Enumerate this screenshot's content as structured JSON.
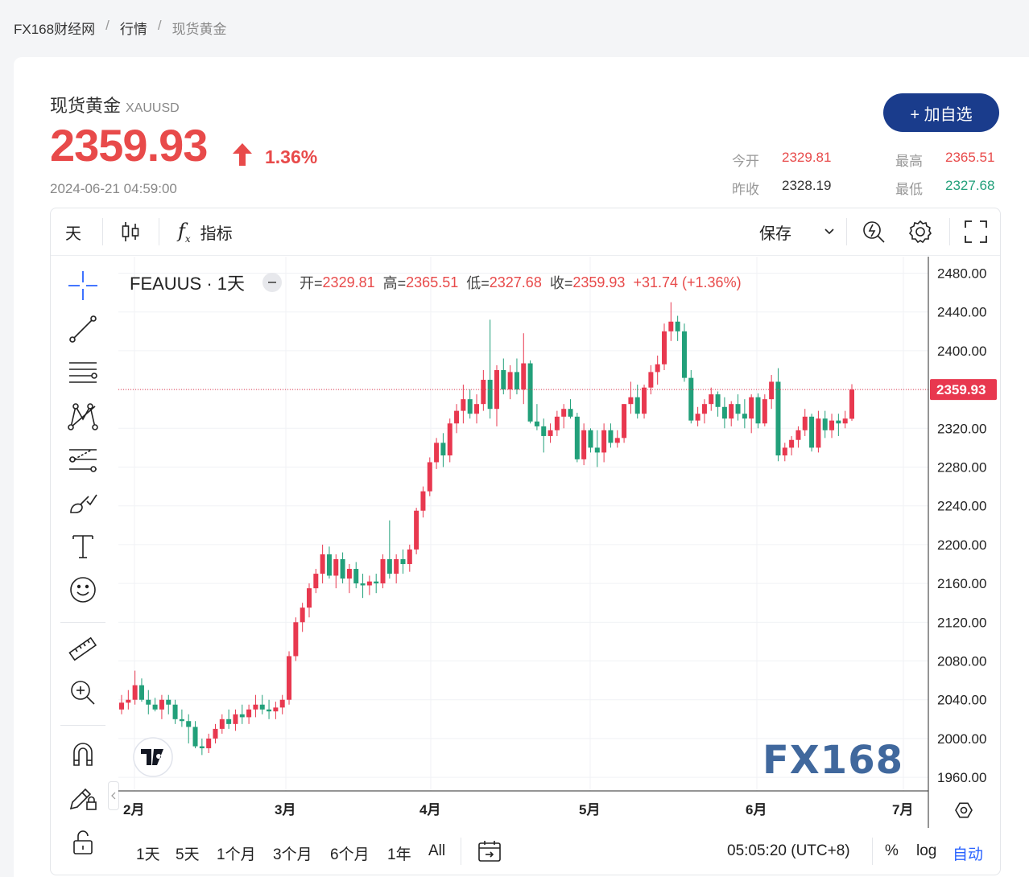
{
  "breadcrumb": [
    "FX168财经网",
    "行情",
    "现货黄金"
  ],
  "quote": {
    "name": "现货黄金",
    "code": "XAUUSD",
    "price": "2359.93",
    "change_pct": "1.36%",
    "time": "2024-06-21 04:59:00",
    "add_label": "+ 加自选",
    "open_label": "今开",
    "open": "2329.81",
    "high_label": "最高",
    "high": "2365.51",
    "prev_label": "昨收",
    "prev": "2328.19",
    "low_label": "最低",
    "low": "2327.68"
  },
  "toolbar": {
    "interval": "天",
    "indicators": "指标",
    "save": "保存"
  },
  "legend": {
    "symbol": "FEAUUS · 1天",
    "o_label": "开=",
    "o": "2329.81",
    "h_label": "高=",
    "h": "2365.51",
    "l_label": "低=",
    "l": "2327.68",
    "c_label": "收=",
    "c": "2359.93",
    "chg": "+31.74 (+1.36%)"
  },
  "bottom": {
    "ranges": [
      "1天",
      "5天",
      "1个月",
      "3个月",
      "6个月",
      "1年",
      "All"
    ],
    "clock": "05:05:20 (UTC+8)",
    "pct": "%",
    "log": "log",
    "auto": "自动"
  },
  "colors": {
    "up": "#e8384f",
    "down": "#22a07a",
    "accent": "#1a3c8c"
  },
  "chart_data": {
    "type": "candlestick",
    "y_ticks": [
      "2480.00",
      "2440.00",
      "2400.00",
      "2360.00",
      "2320.00",
      "2280.00",
      "2240.00",
      "2200.00",
      "2160.00",
      "2120.00",
      "2080.00",
      "2040.00",
      "2000.00",
      "1960.00"
    ],
    "x_ticks": [
      "2月",
      "3月",
      "4月",
      "5月",
      "6月",
      "7月"
    ],
    "ylim": [
      1946,
      2497
    ],
    "last_price": "2359.93",
    "watermark": "FX168",
    "series": [
      {
        "o": 2030,
        "h": 2045,
        "l": 2025,
        "c": 2037
      },
      {
        "o": 2037,
        "h": 2050,
        "l": 2030,
        "c": 2040
      },
      {
        "o": 2040,
        "h": 2070,
        "l": 2035,
        "c": 2055
      },
      {
        "o": 2055,
        "h": 2062,
        "l": 2038,
        "c": 2040
      },
      {
        "o": 2040,
        "h": 2050,
        "l": 2025,
        "c": 2035
      },
      {
        "o": 2035,
        "h": 2042,
        "l": 2028,
        "c": 2030
      },
      {
        "o": 2030,
        "h": 2045,
        "l": 2020,
        "c": 2040
      },
      {
        "o": 2040,
        "h": 2045,
        "l": 2025,
        "c": 2035
      },
      {
        "o": 2035,
        "h": 2040,
        "l": 2015,
        "c": 2020
      },
      {
        "o": 2020,
        "h": 2030,
        "l": 2012,
        "c": 2018
      },
      {
        "o": 2018,
        "h": 2025,
        "l": 1995,
        "c": 2012
      },
      {
        "o": 2012,
        "h": 2018,
        "l": 1990,
        "c": 1992
      },
      {
        "o": 1992,
        "h": 2000,
        "l": 1983,
        "c": 1990
      },
      {
        "o": 1990,
        "h": 2005,
        "l": 1985,
        "c": 2000
      },
      {
        "o": 2000,
        "h": 2015,
        "l": 1995,
        "c": 2010
      },
      {
        "o": 2010,
        "h": 2025,
        "l": 2005,
        "c": 2020
      },
      {
        "o": 2020,
        "h": 2030,
        "l": 2010,
        "c": 2015
      },
      {
        "o": 2015,
        "h": 2030,
        "l": 2008,
        "c": 2025
      },
      {
        "o": 2025,
        "h": 2035,
        "l": 2015,
        "c": 2022
      },
      {
        "o": 2022,
        "h": 2035,
        "l": 2015,
        "c": 2030
      },
      {
        "o": 2030,
        "h": 2045,
        "l": 2022,
        "c": 2035
      },
      {
        "o": 2035,
        "h": 2045,
        "l": 2025,
        "c": 2030
      },
      {
        "o": 2030,
        "h": 2040,
        "l": 2020,
        "c": 2028
      },
      {
        "o": 2028,
        "h": 2038,
        "l": 2020,
        "c": 2032
      },
      {
        "o": 2032,
        "h": 2045,
        "l": 2025,
        "c": 2040
      },
      {
        "o": 2040,
        "h": 2090,
        "l": 2035,
        "c": 2085
      },
      {
        "o": 2085,
        "h": 2125,
        "l": 2080,
        "c": 2120
      },
      {
        "o": 2120,
        "h": 2140,
        "l": 2110,
        "c": 2135
      },
      {
        "o": 2135,
        "h": 2160,
        "l": 2125,
        "c": 2155
      },
      {
        "o": 2155,
        "h": 2175,
        "l": 2150,
        "c": 2170
      },
      {
        "o": 2170,
        "h": 2200,
        "l": 2160,
        "c": 2190
      },
      {
        "o": 2190,
        "h": 2198,
        "l": 2165,
        "c": 2168
      },
      {
        "o": 2168,
        "h": 2190,
        "l": 2155,
        "c": 2185
      },
      {
        "o": 2185,
        "h": 2192,
        "l": 2160,
        "c": 2165
      },
      {
        "o": 2165,
        "h": 2180,
        "l": 2150,
        "c": 2175
      },
      {
        "o": 2175,
        "h": 2182,
        "l": 2155,
        "c": 2160
      },
      {
        "o": 2160,
        "h": 2170,
        "l": 2145,
        "c": 2158
      },
      {
        "o": 2158,
        "h": 2168,
        "l": 2148,
        "c": 2162
      },
      {
        "o": 2162,
        "h": 2170,
        "l": 2150,
        "c": 2160
      },
      {
        "o": 2160,
        "h": 2190,
        "l": 2155,
        "c": 2185
      },
      {
        "o": 2185,
        "h": 2225,
        "l": 2165,
        "c": 2170
      },
      {
        "o": 2170,
        "h": 2190,
        "l": 2160,
        "c": 2185
      },
      {
        "o": 2185,
        "h": 2195,
        "l": 2170,
        "c": 2180
      },
      {
        "o": 2180,
        "h": 2200,
        "l": 2172,
        "c": 2195
      },
      {
        "o": 2195,
        "h": 2238,
        "l": 2190,
        "c": 2235
      },
      {
        "o": 2235,
        "h": 2260,
        "l": 2228,
        "c": 2255
      },
      {
        "o": 2255,
        "h": 2290,
        "l": 2250,
        "c": 2285
      },
      {
        "o": 2285,
        "h": 2310,
        "l": 2278,
        "c": 2305
      },
      {
        "o": 2305,
        "h": 2315,
        "l": 2280,
        "c": 2292
      },
      {
        "o": 2292,
        "h": 2330,
        "l": 2285,
        "c": 2325
      },
      {
        "o": 2325,
        "h": 2345,
        "l": 2315,
        "c": 2338
      },
      {
        "o": 2338,
        "h": 2365,
        "l": 2325,
        "c": 2350
      },
      {
        "o": 2350,
        "h": 2360,
        "l": 2330,
        "c": 2335
      },
      {
        "o": 2335,
        "h": 2355,
        "l": 2325,
        "c": 2345
      },
      {
        "o": 2345,
        "h": 2380,
        "l": 2338,
        "c": 2370
      },
      {
        "o": 2370,
        "h": 2432,
        "l": 2330,
        "c": 2340
      },
      {
        "o": 2340,
        "h": 2385,
        "l": 2322,
        "c": 2380
      },
      {
        "o": 2380,
        "h": 2392,
        "l": 2355,
        "c": 2360
      },
      {
        "o": 2360,
        "h": 2385,
        "l": 2350,
        "c": 2378
      },
      {
        "o": 2378,
        "h": 2392,
        "l": 2355,
        "c": 2360
      },
      {
        "o": 2360,
        "h": 2418,
        "l": 2345,
        "c": 2387
      },
      {
        "o": 2387,
        "h": 2390,
        "l": 2325,
        "c": 2327
      },
      {
        "o": 2327,
        "h": 2345,
        "l": 2318,
        "c": 2322
      },
      {
        "o": 2322,
        "h": 2330,
        "l": 2295,
        "c": 2312
      },
      {
        "o": 2312,
        "h": 2325,
        "l": 2305,
        "c": 2318
      },
      {
        "o": 2318,
        "h": 2338,
        "l": 2312,
        "c": 2332
      },
      {
        "o": 2332,
        "h": 2345,
        "l": 2320,
        "c": 2340
      },
      {
        "o": 2340,
        "h": 2350,
        "l": 2330,
        "c": 2332
      },
      {
        "o": 2332,
        "h": 2336,
        "l": 2285,
        "c": 2288
      },
      {
        "o": 2288,
        "h": 2325,
        "l": 2282,
        "c": 2318
      },
      {
        "o": 2318,
        "h": 2320,
        "l": 2295,
        "c": 2300
      },
      {
        "o": 2300,
        "h": 2318,
        "l": 2280,
        "c": 2295
      },
      {
        "o": 2295,
        "h": 2325,
        "l": 2285,
        "c": 2318
      },
      {
        "o": 2318,
        "h": 2325,
        "l": 2300,
        "c": 2305
      },
      {
        "o": 2305,
        "h": 2318,
        "l": 2300,
        "c": 2310
      },
      {
        "o": 2310,
        "h": 2345,
        "l": 2305,
        "c": 2345
      },
      {
        "o": 2345,
        "h": 2368,
        "l": 2335,
        "c": 2352
      },
      {
        "o": 2352,
        "h": 2365,
        "l": 2330,
        "c": 2335
      },
      {
        "o": 2335,
        "h": 2365,
        "l": 2330,
        "c": 2362
      },
      {
        "o": 2362,
        "h": 2385,
        "l": 2355,
        "c": 2378
      },
      {
        "o": 2378,
        "h": 2395,
        "l": 2365,
        "c": 2386
      },
      {
        "o": 2386,
        "h": 2428,
        "l": 2380,
        "c": 2420
      },
      {
        "o": 2420,
        "h": 2450,
        "l": 2410,
        "c": 2430
      },
      {
        "o": 2430,
        "h": 2436,
        "l": 2410,
        "c": 2420
      },
      {
        "o": 2420,
        "h": 2428,
        "l": 2368,
        "c": 2372
      },
      {
        "o": 2372,
        "h": 2380,
        "l": 2325,
        "c": 2328
      },
      {
        "o": 2328,
        "h": 2342,
        "l": 2322,
        "c": 2335
      },
      {
        "o": 2335,
        "h": 2350,
        "l": 2325,
        "c": 2345
      },
      {
        "o": 2345,
        "h": 2362,
        "l": 2338,
        "c": 2355
      },
      {
        "o": 2355,
        "h": 2358,
        "l": 2332,
        "c": 2342
      },
      {
        "o": 2342,
        "h": 2352,
        "l": 2320,
        "c": 2330
      },
      {
        "o": 2330,
        "h": 2348,
        "l": 2322,
        "c": 2345
      },
      {
        "o": 2345,
        "h": 2355,
        "l": 2328,
        "c": 2335
      },
      {
        "o": 2335,
        "h": 2350,
        "l": 2320,
        "c": 2330
      },
      {
        "o": 2330,
        "h": 2355,
        "l": 2315,
        "c": 2352
      },
      {
        "o": 2352,
        "h": 2356,
        "l": 2320,
        "c": 2325
      },
      {
        "o": 2325,
        "h": 2355,
        "l": 2322,
        "c": 2350
      },
      {
        "o": 2350,
        "h": 2375,
        "l": 2340,
        "c": 2368
      },
      {
        "o": 2368,
        "h": 2382,
        "l": 2286,
        "c": 2292
      },
      {
        "o": 2292,
        "h": 2305,
        "l": 2286,
        "c": 2300
      },
      {
        "o": 2300,
        "h": 2312,
        "l": 2292,
        "c": 2308
      },
      {
        "o": 2308,
        "h": 2322,
        "l": 2300,
        "c": 2318
      },
      {
        "o": 2318,
        "h": 2340,
        "l": 2312,
        "c": 2332
      },
      {
        "o": 2332,
        "h": 2335,
        "l": 2296,
        "c": 2300
      },
      {
        "o": 2300,
        "h": 2338,
        "l": 2295,
        "c": 2330
      },
      {
        "o": 2330,
        "h": 2338,
        "l": 2310,
        "c": 2318
      },
      {
        "o": 2318,
        "h": 2335,
        "l": 2310,
        "c": 2328
      },
      {
        "o": 2328,
        "h": 2335,
        "l": 2312,
        "c": 2325
      },
      {
        "o": 2325,
        "h": 2338,
        "l": 2320,
        "c": 2330
      },
      {
        "o": 2329.81,
        "h": 2365.51,
        "l": 2327.68,
        "c": 2359.93
      }
    ]
  }
}
